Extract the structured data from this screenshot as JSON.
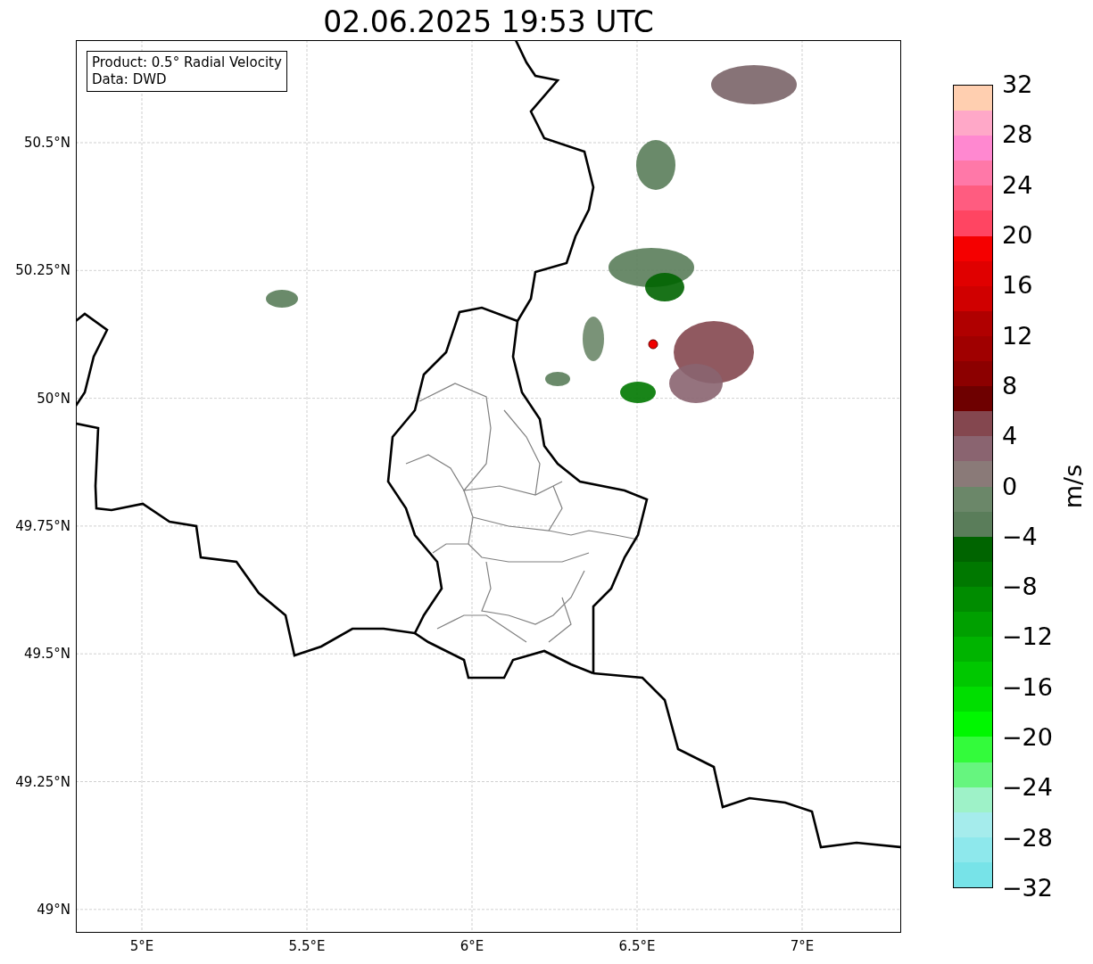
{
  "title": "02.06.2025 19:53 UTC",
  "info_box": [
    "Product: 0.5° Radial Velocity",
    "Data: DWD"
  ],
  "map": {
    "lat_ticks": [
      "50.5°N",
      "50.25°N",
      "50°N",
      "49.75°N",
      "49.5°N",
      "49.25°N",
      "49°N"
    ],
    "lon_ticks": [
      "5°E",
      "5.5°E",
      "6°E",
      "6.5°E",
      "7°E"
    ]
  },
  "colorbar": {
    "label": "m/s",
    "ticks": [
      "32",
      "28",
      "24",
      "20",
      "16",
      "12",
      "8",
      "4",
      "0",
      "−4",
      "−8",
      "−12",
      "−16",
      "−20",
      "−24",
      "−28",
      "−32"
    ],
    "bands": [
      {
        "color": "#ffcfb0"
      },
      {
        "color": "#ffa8c8"
      },
      {
        "color": "#ff88d0"
      },
      {
        "color": "#ff78a8"
      },
      {
        "color": "#ff5c80"
      },
      {
        "color": "#ff4562"
      },
      {
        "color": "#f50000"
      },
      {
        "color": "#e00000"
      },
      {
        "color": "#d00000"
      },
      {
        "color": "#b00000"
      },
      {
        "color": "#a00000"
      },
      {
        "color": "#8c0000"
      },
      {
        "color": "#6e0000"
      },
      {
        "color": "#84474f"
      },
      {
        "color": "#8a6470"
      },
      {
        "color": "#8a7a78"
      },
      {
        "color": "#6b8769"
      },
      {
        "color": "#5a7d5a"
      },
      {
        "color": "#006400"
      },
      {
        "color": "#007800"
      },
      {
        "color": "#008c00"
      },
      {
        "color": "#00a000"
      },
      {
        "color": "#00b400"
      },
      {
        "color": "#00c800"
      },
      {
        "color": "#00de00"
      },
      {
        "color": "#00f700"
      },
      {
        "color": "#33fb3b"
      },
      {
        "color": "#66f57f"
      },
      {
        "color": "#9ef2c8"
      },
      {
        "color": "#a5ecec"
      },
      {
        "color": "#8ee8ec"
      },
      {
        "color": "#77e3e8"
      }
    ]
  }
}
